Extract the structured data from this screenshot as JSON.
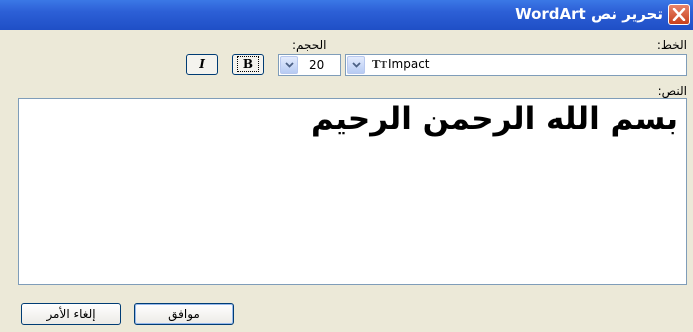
{
  "window": {
    "title": "تحرير نص WordArt"
  },
  "labels": {
    "font": "الخط:",
    "size": "الحجم:",
    "text": "النص:"
  },
  "font": {
    "value": "Impact",
    "icon": "truetype-icon"
  },
  "size": {
    "value": "20"
  },
  "format": {
    "bold": "B",
    "italic": "I"
  },
  "content": {
    "text": "بسم الله الرحمن الرحيم"
  },
  "buttons": {
    "ok": "موافق",
    "cancel": "إلغاء الأمر"
  },
  "colors": {
    "titlebar": "#2c5fd6",
    "close": "#d84a25",
    "face": "#ece9d8"
  }
}
